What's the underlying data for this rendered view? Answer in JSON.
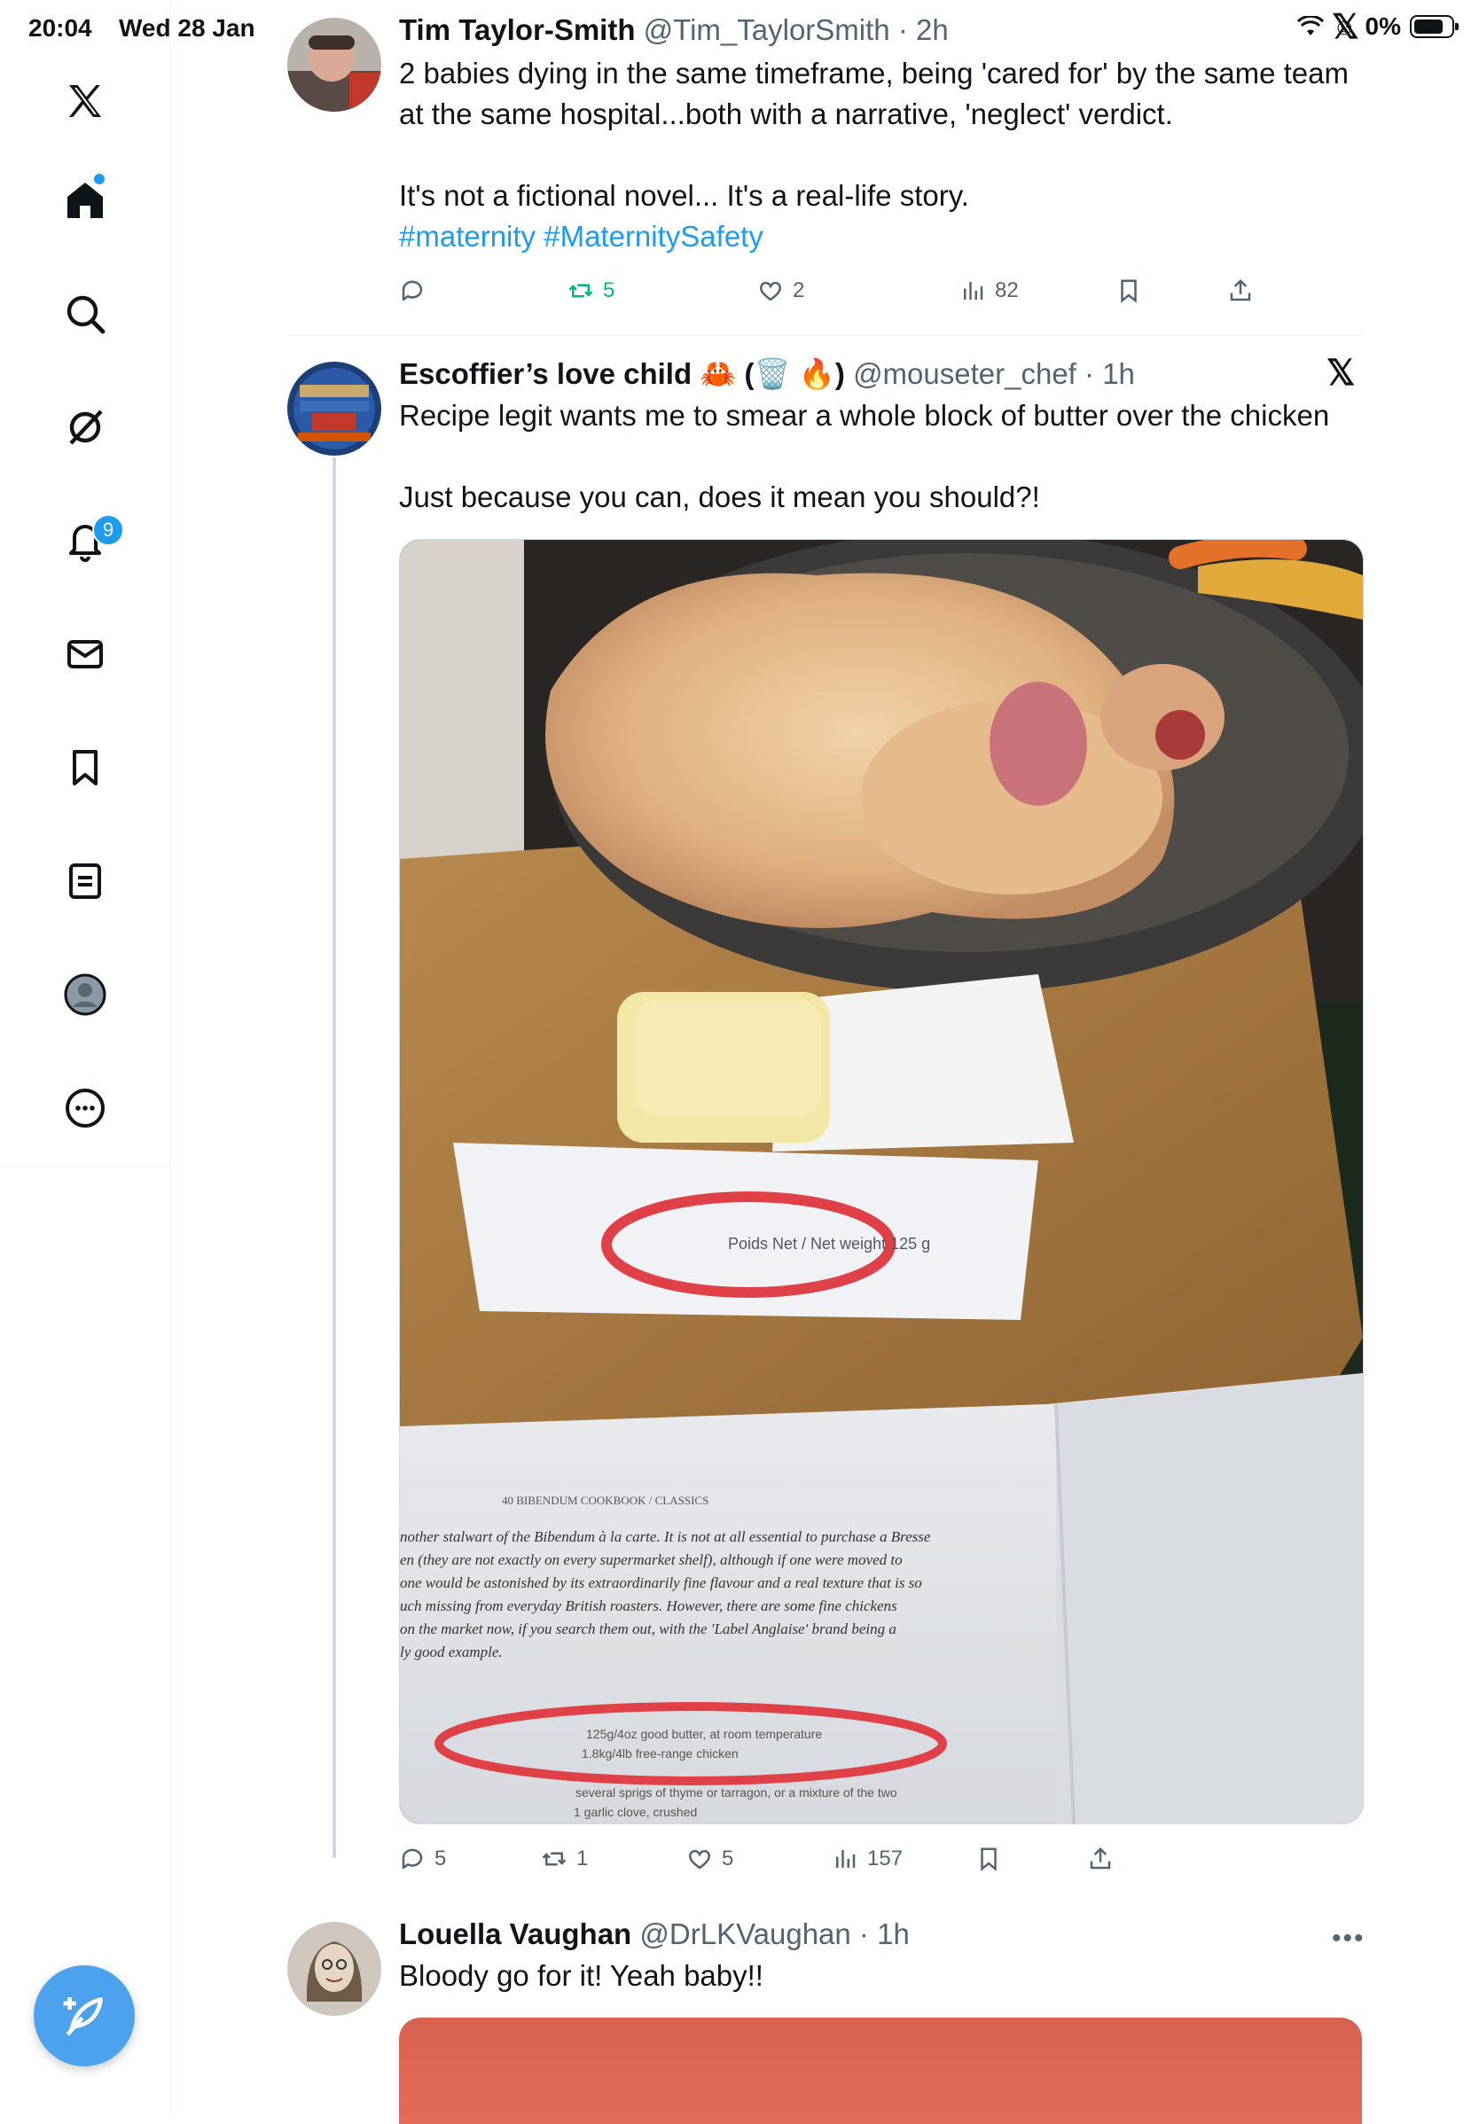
{
  "status_bar": {
    "time": "20:04",
    "date": "Wed 28 Jan",
    "battery": "0%"
  },
  "sidebar": {
    "items": [
      {
        "name": "x-logo"
      },
      {
        "name": "home"
      },
      {
        "name": "search"
      },
      {
        "name": "grok"
      },
      {
        "name": "notifications"
      },
      {
        "name": "messages"
      },
      {
        "name": "bookmarks"
      },
      {
        "name": "lists"
      },
      {
        "name": "profile"
      },
      {
        "name": "more"
      }
    ],
    "notification_count": "9"
  },
  "tweets": [
    {
      "name": "Tim Taylor-Smith",
      "handle": "@Tim_TaylorSmith",
      "time": "2h",
      "text_lines": [
        "2 babies dying in the same timeframe, being 'cared for' by the same team at the same hospital...both with a narrative, 'neglect' verdict.",
        "It's not a fictional novel... It's a real-life story."
      ],
      "hashtags": "#maternity #MaternitySafety",
      "replies": "",
      "retweets": "5",
      "likes": "2",
      "views": "82"
    },
    {
      "name": "Escoffier’s love child",
      "name_emoji": "🦀 (🗑️ 🔥)",
      "handle": "@mouseter_chef",
      "time": "1h",
      "text_lines": [
        "Recipe legit wants me to smear a whole block of butter over the chicken",
        "Just because you can, does it mean you should?!"
      ],
      "image": {
        "butter_label": "Poids Net / Net weight 125 g",
        "book_header": "40  BIBENDUM COOKBOOK / CLASSICS",
        "book_text": [
          "nother stalwart of the Bibendum à la carte. It is not at all essential to purchase a Bresse",
          "en (they are not exactly on every supermarket shelf), although if one were moved to",
          "one would be astonished by its extraordinarily fine flavour and a real texture that is so",
          "uch missing from everyday British roasters. However, there are some fine chickens",
          "on the market now, if you search them out, with the 'Label Anglaise' brand being a",
          "ly good example."
        ],
        "ingredients": [
          "125g/4oz good butter, at room temperature",
          "1.8kg/4lb free-range chicken",
          "several sprigs of thyme or tarragon, or a mixture of the two",
          "1 garlic clove, crushed"
        ]
      },
      "replies": "5",
      "retweets": "1",
      "likes": "5",
      "views": "157"
    },
    {
      "name": "Louella Vaughan",
      "handle": "@DrLKVaughan",
      "time": "1h",
      "text_lines": [
        "Bloody go for it! Yeah baby!!"
      ]
    }
  ],
  "colors": {
    "accent": "#1d9bf0",
    "muted": "#536471",
    "retweet_green": "#00ba7c"
  }
}
